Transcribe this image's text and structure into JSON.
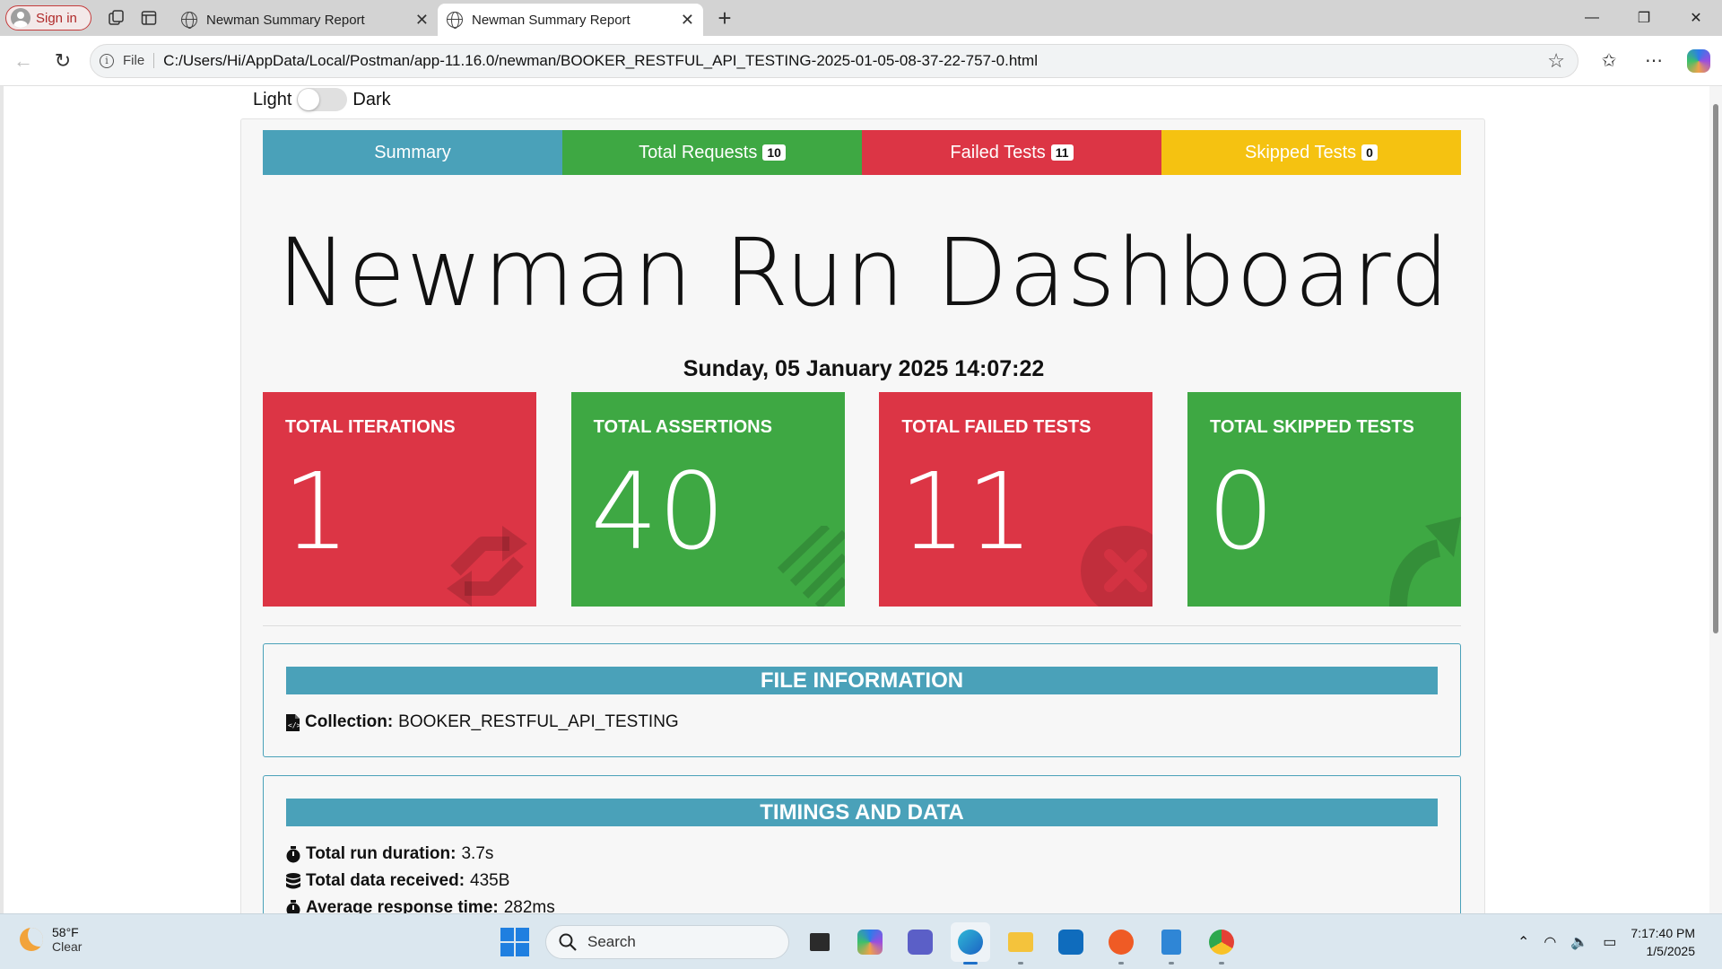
{
  "browser": {
    "signin_label": "Sign in",
    "tabs": [
      {
        "title": "Newman Summary Report",
        "active": false
      },
      {
        "title": "Newman Summary Report",
        "active": true
      }
    ],
    "file_label": "File",
    "url": "C:/Users/Hi/AppData/Local/Postman/app-11.16.0/newman/BOOKER_RESTFUL_API_TESTING-2025-01-05-08-37-22-757-0.html"
  },
  "theme_toggle": {
    "light_label": "Light",
    "dark_label": "Dark",
    "mode": "light"
  },
  "nav_tabs": [
    {
      "label": "Summary",
      "badge": null,
      "color": "#4aa1b9"
    },
    {
      "label": "Total Requests",
      "badge": "10",
      "color": "#3ea843"
    },
    {
      "label": "Failed Tests",
      "badge": "11",
      "color": "#dc3545"
    },
    {
      "label": "Skipped Tests",
      "badge": "0",
      "color": "#f5c211"
    }
  ],
  "dashboard": {
    "title": "Newman Run Dashboard",
    "run_date": "Sunday, 05 January 2025 14:07:22"
  },
  "cards": [
    {
      "label": "TOTAL ITERATIONS",
      "value": "1",
      "color": "#dc3545",
      "icon": "sync-icon"
    },
    {
      "label": "TOTAL ASSERTIONS",
      "value": "40",
      "color": "#3ea843",
      "icon": "list-check-icon"
    },
    {
      "label": "TOTAL FAILED TESTS",
      "value": "11",
      "color": "#dc3545",
      "icon": "times-circle-icon"
    },
    {
      "label": "TOTAL SKIPPED TESTS",
      "value": "0",
      "color": "#3ea843",
      "icon": "share-arrow-icon"
    }
  ],
  "file_info": {
    "heading": "FILE INFORMATION",
    "collection_label": "Collection:",
    "collection_value": "BOOKER_RESTFUL_API_TESTING"
  },
  "timings": {
    "heading": "TIMINGS AND DATA",
    "rows": [
      {
        "label": "Total run duration:",
        "value": "3.7s",
        "icon": "stopwatch-icon"
      },
      {
        "label": "Total data received:",
        "value": "435B",
        "icon": "database-icon"
      },
      {
        "label": "Average response time:",
        "value": "282ms",
        "icon": "stopwatch-icon"
      }
    ]
  },
  "taskbar": {
    "weather_temp": "58°F",
    "weather_desc": "Clear",
    "search_placeholder": "Search",
    "time": "7:17:40 PM",
    "date": "1/5/2025"
  }
}
